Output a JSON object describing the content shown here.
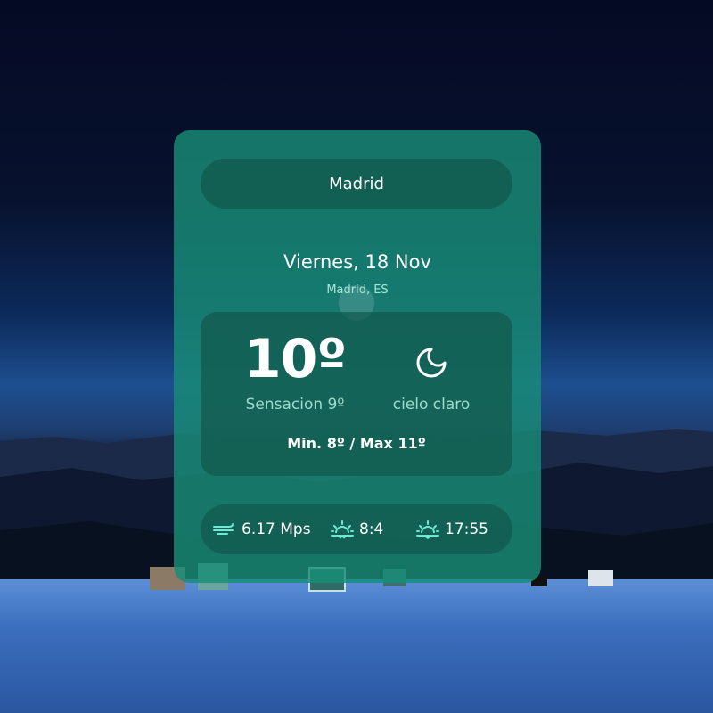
{
  "weather": {
    "city": "Madrid",
    "date": "Viernes, 18 Nov",
    "location": "Madrid, ES",
    "temperature": "10º",
    "feels_like": "Sensacion 9º",
    "condition": "cielo claro",
    "condition_icon": "crescent-moon-icon",
    "min_max": "Min. 8º / Max 11º"
  },
  "stats": {
    "wind": {
      "icon": "wind-icon",
      "value": "6.17 Mps"
    },
    "sunrise": {
      "icon": "sunrise-icon",
      "value": "8:4"
    },
    "sunset": {
      "icon": "sunset-icon",
      "value": "17:55"
    }
  },
  "colors": {
    "card": "#198c76",
    "panel": "#12584c",
    "icon_accent": "#6ee8cf",
    "muted_text": "#9fd9ca"
  }
}
